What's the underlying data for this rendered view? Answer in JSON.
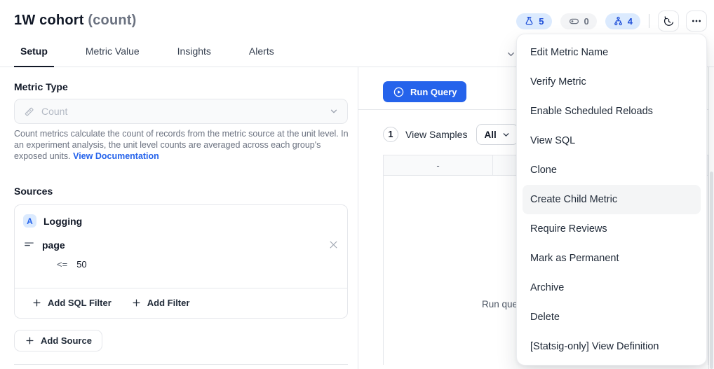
{
  "header": {
    "title": "1W cohort",
    "subtitle": "(count)",
    "badges": [
      {
        "name": "experiments-badge",
        "icon": "flask-icon",
        "count": "5",
        "variant": "blue"
      },
      {
        "name": "gates-badge",
        "icon": "toggle-icon",
        "count": "0",
        "variant": "gray"
      },
      {
        "name": "lineage-badge",
        "icon": "org-icon",
        "count": "4",
        "variant": "blue"
      }
    ]
  },
  "tabs": [
    {
      "label": "Setup",
      "active": true
    },
    {
      "label": "Metric Value",
      "active": false
    },
    {
      "label": "Insights",
      "active": false
    },
    {
      "label": "Alerts",
      "active": false
    }
  ],
  "metric_type": {
    "label": "Metric Type",
    "value": "Count",
    "description": "Count metrics calculate the count of records from the metric source at the unit level. In an experiment analysis, the unit level counts are averaged across each group's exposed units.",
    "doc_link_label": "View Documentation"
  },
  "sources": {
    "label": "Sources",
    "source_avatar": "A",
    "source_name": "Logging",
    "filter_field": "page",
    "filter_operator": "<=",
    "filter_value": "50",
    "add_sql_filter_label": "Add SQL Filter",
    "add_filter_label": "Add Filter",
    "add_source_label": "Add Source"
  },
  "query_panel": {
    "run_query_label": "Run Query",
    "step_number": "1",
    "view_samples_label": "View Samples",
    "samples_select_value": "All",
    "table_header": "-",
    "body_text": "Run que"
  },
  "context_menu": {
    "items": [
      {
        "label": "Edit Metric Name",
        "hovered": false
      },
      {
        "label": "Verify Metric",
        "hovered": false
      },
      {
        "label": "Enable Scheduled Reloads",
        "hovered": false
      },
      {
        "label": "View SQL",
        "hovered": false
      },
      {
        "label": "Clone",
        "hovered": false
      },
      {
        "label": "Create Child Metric",
        "hovered": true
      },
      {
        "label": "Require Reviews",
        "hovered": false
      },
      {
        "label": "Mark as Permanent",
        "hovered": false
      },
      {
        "label": "Archive",
        "hovered": false
      },
      {
        "label": "Delete",
        "hovered": false
      },
      {
        "label": "[Statsig-only] View Definition",
        "hovered": false
      }
    ]
  },
  "colors": {
    "accent_blue": "#2563eb",
    "badge_blue_bg": "#dbeafe",
    "badge_blue_text": "#1d4ed8",
    "badge_gray_bg": "#f3f4f6",
    "badge_gray_text": "#6b7280",
    "border": "#e5e7eb",
    "text_primary": "#111827",
    "text_secondary": "#6b7280",
    "menu_hover_bg": "#f4f5f6",
    "table_header_bg": "#f9fafb"
  }
}
